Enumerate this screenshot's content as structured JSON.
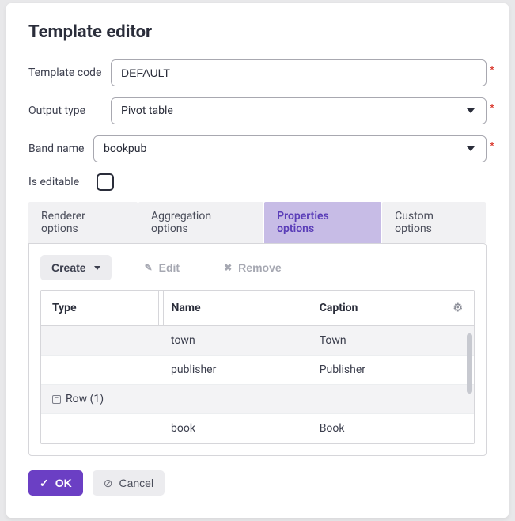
{
  "dialog": {
    "title": "Template editor"
  },
  "fields": {
    "template_code": {
      "label": "Template code",
      "value": "DEFAULT"
    },
    "output_type": {
      "label": "Output type",
      "value": "Pivot table"
    },
    "band_name": {
      "label": "Band name",
      "value": "bookpub"
    },
    "is_editable": {
      "label": "Is editable",
      "checked": false
    }
  },
  "tabs": {
    "renderer": "Renderer options",
    "aggregation": "Aggregation options",
    "properties": "Properties options",
    "custom": "Custom options"
  },
  "toolbar": {
    "create": "Create",
    "edit": "Edit",
    "remove": "Remove"
  },
  "table": {
    "headers": {
      "type": "Type",
      "name": "Name",
      "caption": "Caption"
    },
    "rows": {
      "r0": {
        "type": "",
        "name": "town",
        "caption": "Town"
      },
      "r1": {
        "type": "",
        "name": "publisher",
        "caption": "Publisher"
      },
      "group": {
        "label": "Row (1)"
      },
      "r2": {
        "type": "",
        "name": "book",
        "caption": "Book"
      }
    }
  },
  "footer": {
    "ok": "OK",
    "cancel": "Cancel"
  }
}
